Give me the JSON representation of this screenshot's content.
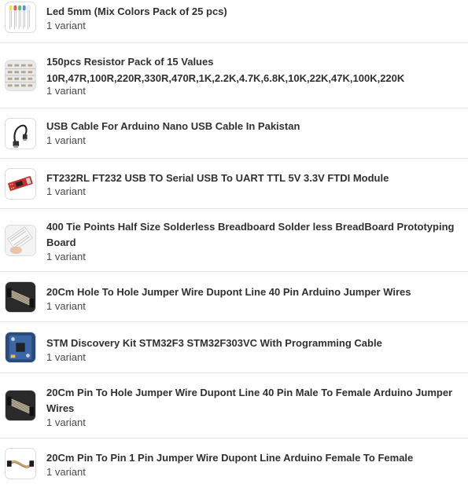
{
  "products": [
    {
      "title": "Led 5mm (Mix Colors Pack of 25 pcs)",
      "variants": "1 variant",
      "thumb_icon": "led-icon"
    },
    {
      "title": "150pcs Resistor Pack of 15 Values",
      "title_line2": "10R,47R,100R,220R,330R,470R,1K,2.2K,4.7K,6.8K,10K,22K,47K,100K,220K",
      "variants": "1 variant",
      "thumb_icon": "resistor-pack-icon"
    },
    {
      "title": "USB Cable For Arduino Nano USB Cable In Pakistan",
      "variants": "1 variant",
      "thumb_icon": "usb-cable-icon"
    },
    {
      "title": "FT232RL FT232 USB TO Serial USB To UART TTL 5V 3.3V FTDI Module",
      "variants": "1 variant",
      "thumb_icon": "ftdi-module-icon"
    },
    {
      "title": "400 Tie Points Half Size Solderless Breadboard Solder less BreadBoard Prototyping Board",
      "variants": "1 variant",
      "thumb_icon": "breadboard-icon"
    },
    {
      "title": "20Cm Hole To Hole Jumper Wire Dupont Line 40 Pin Arduino Jumper Wires",
      "variants": "1 variant",
      "thumb_icon": "jumper-wires-icon"
    },
    {
      "title": "STM Discovery Kit STM32F3 STM32F303VC With Programming Cable",
      "variants": "1 variant",
      "thumb_icon": "stm-board-icon"
    },
    {
      "title": "20Cm Pin To Hole Jumper Wire Dupont Line 40 Pin Male To Female Arduino Jumper Wires",
      "variants": "1 variant",
      "thumb_icon": "jumper-wires-icon"
    },
    {
      "title": "20Cm Pin To Pin 1 Pin Jumper Wire Dupont Line Arduino Female To Female",
      "variants": "1 variant",
      "thumb_icon": "single-jumper-icon"
    }
  ]
}
